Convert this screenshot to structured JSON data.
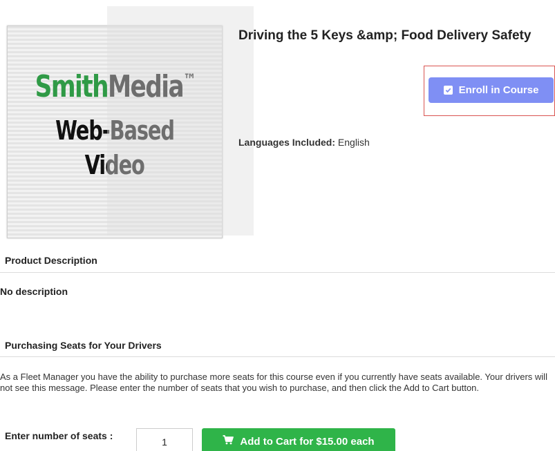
{
  "product": {
    "image": {
      "brand_smith": "Smith",
      "brand_media": "Media",
      "brand_tm": "™",
      "line1": "Web-Based",
      "line2": "Video"
    },
    "title": "Driving the 5 Keys &amp; Food Delivery Safety",
    "enroll_label": "Enroll in Course",
    "languages_label": "Languages Included:",
    "languages_value": "English"
  },
  "description": {
    "heading": "Product Description",
    "text": "No description"
  },
  "purchasing": {
    "heading": "Purchasing Seats for Your Drivers",
    "paragraph": "As a Fleet Manager you have the ability to purchase more seats for this course even if you currently have seats available. Your drivers will not see this message. Please enter the number of seats that you wish to purchase, and then click the Add to Cart button.",
    "seats_label": "Enter number of seats :",
    "seats_value": "1",
    "cart_label": "Add to Cart for $15.00 each"
  },
  "colors": {
    "enroll_button": "#7f8ff4",
    "enroll_frame": "#d9534f",
    "cart_button": "#2fb449",
    "brand_green": "#2f9a46"
  },
  "icons": {
    "enroll": "check-square-icon",
    "cart": "shopping-cart-icon"
  }
}
